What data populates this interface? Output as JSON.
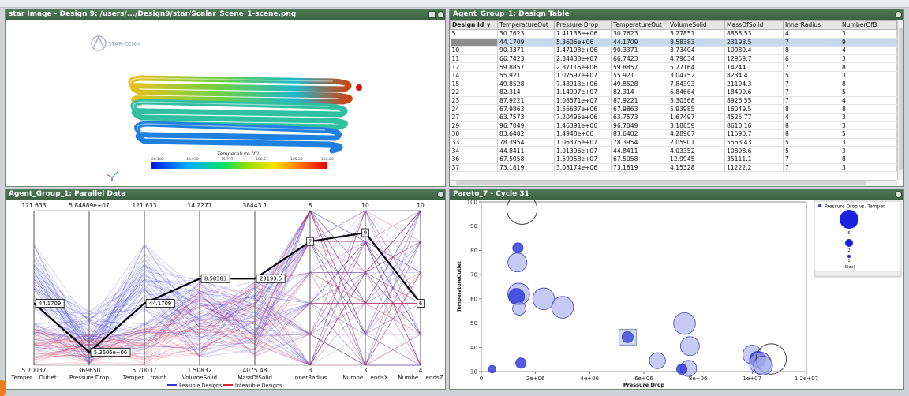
{
  "image_panel": {
    "title": "star Image - Design 9: /users/.../Design9/star/Scalar_Scene_1-scene.png",
    "logo_text": "STAR-CCM+",
    "legend_title": "Temperature (C)",
    "legend_ticks": [
      "28.182",
      "48.938",
      "75.717",
      "100.51",
      "125.23",
      "150.00"
    ]
  },
  "table_panel": {
    "title": "Agent_Group_1: Design Table",
    "columns": [
      "Design Id",
      "TemperatureOut",
      "Pressure Drop",
      "TemperatureOut",
      "VolumeSolid",
      "MassOfSolid",
      "InnerRadius",
      "NumberOfB"
    ],
    "rows": [
      [
        "5",
        "30.7623",
        "7.41138e+06",
        "30.7623",
        "3.27851",
        "8858.53",
        "4",
        "3"
      ],
      [
        "9",
        "44.1709",
        "5.3606e+06",
        "44.1709",
        "8.58383",
        "23193.5",
        "7",
        "9"
      ],
      [
        "10",
        "90.3371",
        "1.47108e+06",
        "90.3371",
        "3.73404",
        "10089.4",
        "8",
        "4"
      ],
      [
        "11",
        "66.7423",
        "2.34438e+07",
        "66.7423",
        "4.79634",
        "12959.7",
        "6",
        "3"
      ],
      [
        "12",
        "59.8857",
        "2.37115e+06",
        "59.8857",
        "5.27164",
        "14244",
        "7",
        "8"
      ],
      [
        "14",
        "55.921",
        "1.07597e+07",
        "55.921",
        "3.04752",
        "8234.4",
        "5",
        "3"
      ],
      [
        "15",
        "49.8528",
        "7.48913e+06",
        "49.8528",
        "7.84393",
        "21194.3",
        "7",
        "8"
      ],
      [
        "22",
        "82.314",
        "1.14997e+07",
        "82.314",
        "6.84664",
        "18499.6",
        "7",
        "5"
      ],
      [
        "23",
        "87.9221",
        "1.08571e+07",
        "87.9221",
        "3.30368",
        "8926.55",
        "7",
        "4"
      ],
      [
        "24",
        "67.9863",
        "1.56637e+06",
        "67.9863",
        "5.93985",
        "16049.5",
        "8",
        "8"
      ],
      [
        "27",
        "63.7573",
        "7.20495e+06",
        "63.7573",
        "1.67497",
        "4525.77",
        "4",
        "3"
      ],
      [
        "29",
        "96.7049",
        "1.46391e+06",
        "96.7049",
        "3.18659",
        "8610.16",
        "8",
        "3"
      ],
      [
        "30",
        "83.6402",
        "1.4948e+06",
        "83.6402",
        "4.28967",
        "11590.7",
        "8",
        "5"
      ],
      [
        "33",
        "78.3954",
        "1.06376e+07",
        "78.3954",
        "2.05901",
        "5563.43",
        "5",
        "3"
      ],
      [
        "34",
        "44.8411",
        "1.01396e+07",
        "44.8411",
        "4.03352",
        "10898.6",
        "5",
        "3"
      ],
      [
        "36",
        "67.5058",
        "1.59958e+07",
        "67.5058",
        "12.9945",
        "35111.1",
        "7",
        "8"
      ],
      [
        "37",
        "73.1819",
        "3.08174e+06",
        "73.1819",
        "4.15328",
        "11222.2",
        "7",
        "3"
      ]
    ]
  },
  "parallel_panel": {
    "title": "Agent_Group_1: Parallel Data",
    "axes": [
      {
        "top": "121.633",
        "bottom": "5.70037",
        "label": "Temper....Outlet",
        "sel": 0.4
      },
      {
        "top": "5.84889e+07",
        "bottom": "369650",
        "label": "Pressure Drop",
        "sel": 0.085
      },
      {
        "top": "121.633",
        "bottom": "5.70037",
        "label": "Temper....traint",
        "sel": 0.4
      },
      {
        "top": "14.2277",
        "bottom": "1.50832",
        "label": "VolumeSolid",
        "sel": 0.56
      },
      {
        "top": "38443.1",
        "bottom": "4075.48",
        "label": "MassOfSolid",
        "sel": 0.56
      },
      {
        "top": "8",
        "bottom": "3",
        "label": "InnerRadius",
        "sel": 0.8
      },
      {
        "top": "10",
        "bottom": "3",
        "label": "Numbe....endsX",
        "sel": 0.857
      },
      {
        "top": "10",
        "bottom": "4",
        "label": "Numbe....endsZ",
        "sel": 0.4
      }
    ],
    "selected_labels": [
      "44.1709",
      "5.3606e+06",
      "44.1709",
      "8.58383",
      "23193.5",
      "7",
      "9",
      "6"
    ],
    "legend": [
      "Feasible Designs",
      "Infeasible Designs"
    ],
    "colors": {
      "feasible": "#3333dd",
      "infeasible": "#dd2233",
      "selected": "#000000"
    }
  },
  "pareto_panel": {
    "title": "Pareto_7 - Cycle 31",
    "chart_data": {
      "type": "scatter",
      "xlabel": "Pressure Drop",
      "ylabel": "TemperatureOutlet",
      "xlim": [
        0,
        12000000
      ],
      "ylim": [
        30,
        100
      ],
      "xticks": [
        "0",
        "2e+06",
        "4e+06",
        "6e+06",
        "8e+06",
        "1e+07",
        "1.2e+07"
      ],
      "yticks": [
        "30",
        "40",
        "50",
        "60",
        "70",
        "80",
        "90",
        "100"
      ],
      "series": [
        {
          "name": "Pressure Drop vs. Temper",
          "points": [
            {
              "x": 1500000,
              "y": 97,
              "size": 9,
              "style": "outline"
            },
            {
              "x": 1350000,
              "y": 81,
              "size": 2,
              "style": "dark"
            },
            {
              "x": 1330000,
              "y": 75,
              "size": 5,
              "style": "light"
            },
            {
              "x": 1380000,
              "y": 62,
              "size": 6,
              "style": "light"
            },
            {
              "x": 1300000,
              "y": 61,
              "size": 4,
              "style": "dark"
            },
            {
              "x": 1400000,
              "y": 56,
              "size": 3,
              "style": "light"
            },
            {
              "x": 2300000,
              "y": 60,
              "size": 6,
              "style": "light"
            },
            {
              "x": 3000000,
              "y": 56.5,
              "size": 6,
              "style": "light"
            },
            {
              "x": 1460000,
              "y": 33.5,
              "size": 2,
              "style": "dark"
            },
            {
              "x": 400000,
              "y": 31,
              "size": 1,
              "style": "dark"
            },
            {
              "x": 5400000,
              "y": 44.2,
              "size": 3,
              "style": "selected"
            },
            {
              "x": 7500000,
              "y": 49.8,
              "size": 6,
              "style": "light"
            },
            {
              "x": 7700000,
              "y": 40.5,
              "size": 5,
              "style": "light"
            },
            {
              "x": 7650000,
              "y": 31.3,
              "size": 4,
              "style": "light"
            },
            {
              "x": 7400000,
              "y": 31,
              "size": 2,
              "style": "dark"
            },
            {
              "x": 6500000,
              "y": 34.5,
              "size": 4,
              "style": "light"
            },
            {
              "x": 10000000,
              "y": 37,
              "size": 5,
              "style": "light"
            },
            {
              "x": 10200000,
              "y": 35,
              "size": 4,
              "style": "dark"
            },
            {
              "x": 10300000,
              "y": 33.5,
              "size": 6,
              "style": "light"
            },
            {
              "x": 10700000,
              "y": 35.2,
              "size": 9,
              "style": "outline"
            },
            {
              "x": 10400000,
              "y": 32.5,
              "size": 5,
              "style": "light"
            }
          ]
        }
      ]
    },
    "legend_title": "Pressure Drop vs. Temper",
    "legend_sizes": [
      "5",
      "2",
      "1"
    ],
    "legend_caption": "(Size)"
  }
}
